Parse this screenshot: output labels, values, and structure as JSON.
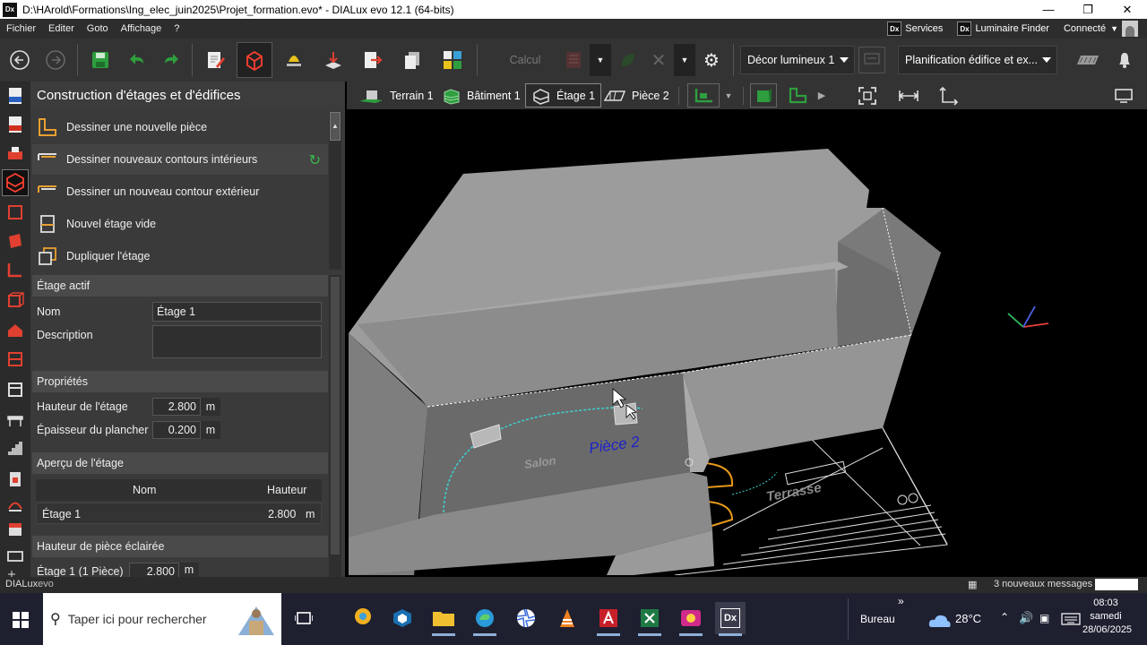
{
  "window": {
    "title": "D:\\HArold\\Formations\\Ing_elec_juin2025\\Projet_formation.evo* - DIALux evo 12.1  (64-bits)",
    "app_badge": "Dx"
  },
  "menu": {
    "items": [
      "Fichier",
      "Editer",
      "Goto",
      "Affichage",
      "?"
    ],
    "services": "Services",
    "luminaire_finder": "Luminaire Finder",
    "connected": "Connecté"
  },
  "toolbar": {
    "calc_label": "Calcul",
    "scene_dropdown": "Décor lumineux 1",
    "planning_dropdown": "Planification édifice et ex..."
  },
  "panel": {
    "title": "Construction d'étages et d'édifices",
    "actions": [
      "Dessiner une nouvelle pièce",
      "Dessiner nouveaux contours intérieurs",
      "Dessiner un nouveau contour extérieur",
      "Nouvel étage vide",
      "Dupliquer l'étage"
    ],
    "active_floor": {
      "header": "Étage actif",
      "name_label": "Nom",
      "name_value": "Étage 1",
      "desc_label": "Description",
      "desc_value": ""
    },
    "properties": {
      "header": "Propriétés",
      "height_label": "Hauteur de l'étage",
      "height_value": "2.800",
      "thickness_label": "Épaisseur du plancher",
      "thickness_value": "0.200",
      "unit": "m"
    },
    "overview": {
      "header": "Aperçu de l'étage",
      "col_name": "Nom",
      "col_height": "Hauteur",
      "row_name": "Étage 1",
      "row_height": "2.800",
      "unit": "m"
    },
    "lit_height": {
      "header": "Hauteur de pièce éclairée",
      "row_label": "Étage 1 (1 Pièce)",
      "row_value": "2.800",
      "unit": "m"
    }
  },
  "view_tabs": [
    "Terrain 1",
    "Bâtiment 1",
    "Étage 1",
    "Pièce 2"
  ],
  "viewport": {
    "label_room": "Pièce 2",
    "label_salon": "Salon",
    "label_terrasse": "Terrasse",
    "colors": {
      "wall": "#8a8a8a",
      "label_room": "#1e24c8"
    }
  },
  "status": {
    "brand_dia": "DIALux",
    "brand_evo": "evo",
    "messages": "3 nouveaux messages"
  },
  "taskbar": {
    "search_placeholder": "Taper ici pour rechercher",
    "location": "Bureau",
    "temperature": "28°C",
    "time": "08:03",
    "day": "samedi",
    "date": "28/06/2025",
    "dx_label": "Dx"
  }
}
